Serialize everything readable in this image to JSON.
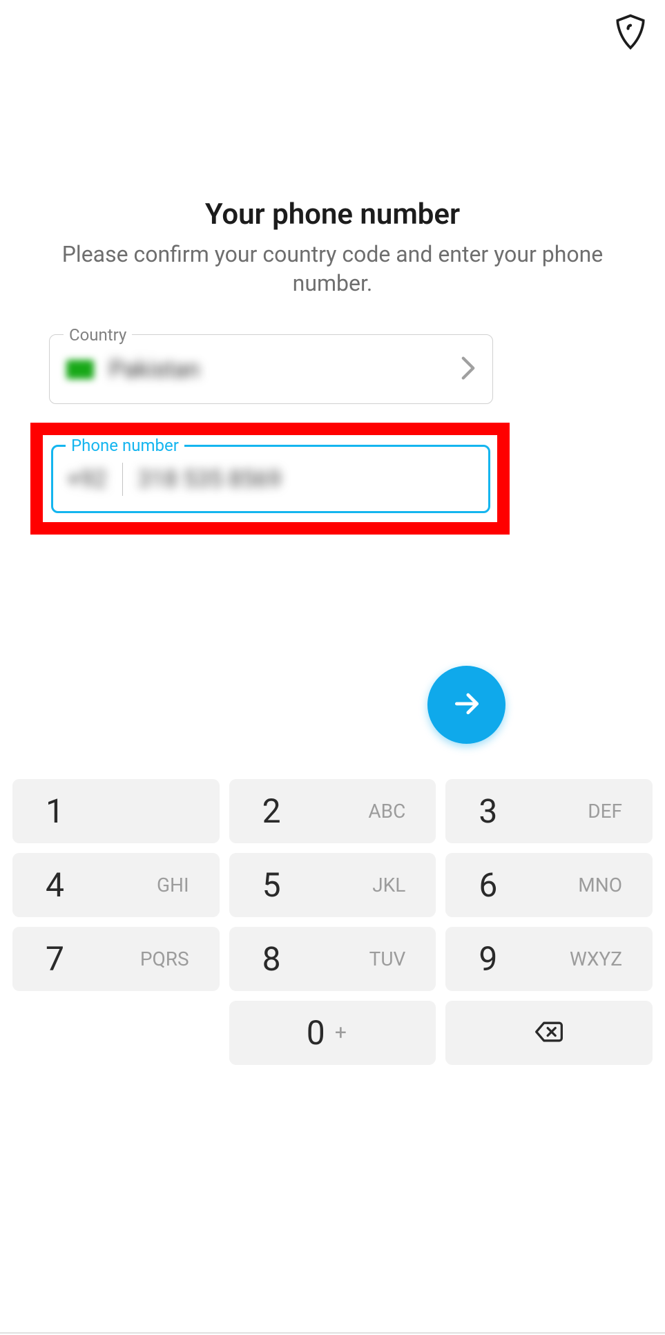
{
  "header": {
    "shield_icon": "shield-icon"
  },
  "title": "Your phone number",
  "subtitle": "Please confirm your country code and enter your phone number.",
  "country_field": {
    "label": "Country",
    "name": "Pakistan"
  },
  "phone_field": {
    "label": "Phone number",
    "country_code": "+92",
    "number": "318 535 8569"
  },
  "fab": {
    "icon": "arrow-right-icon"
  },
  "keypad": [
    {
      "digit": "1",
      "letters": ""
    },
    {
      "digit": "2",
      "letters": "ABC"
    },
    {
      "digit": "3",
      "letters": "DEF"
    },
    {
      "digit": "4",
      "letters": "GHI"
    },
    {
      "digit": "5",
      "letters": "JKL"
    },
    {
      "digit": "6",
      "letters": "MNO"
    },
    {
      "digit": "7",
      "letters": "PQRS"
    },
    {
      "digit": "8",
      "letters": "TUV"
    },
    {
      "digit": "9",
      "letters": "WXYZ"
    },
    {
      "digit": "",
      "letters": ""
    },
    {
      "digit": "0",
      "letters": "+"
    },
    {
      "digit": "backspace",
      "letters": ""
    }
  ]
}
